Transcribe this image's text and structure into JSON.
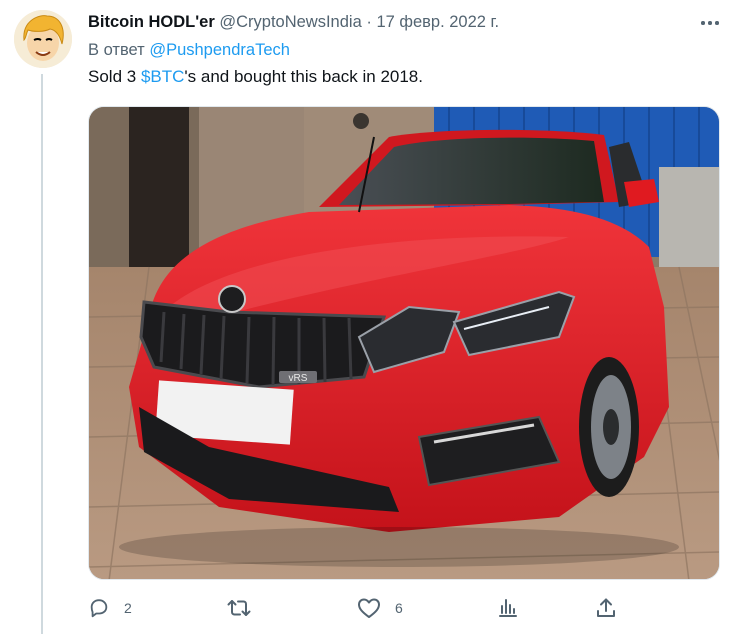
{
  "author": {
    "display_name": "Bitcoin HODL'er",
    "handle": "@CryptoNewsIndia",
    "separator": "·",
    "date": "17 февр. 2022 г."
  },
  "reply": {
    "prefix": "В ответ",
    "to_handle": "@PushpendraTech"
  },
  "text": {
    "before": "Sold 3 ",
    "cashtag": "$BTC",
    "after": "'s and bought this back in 2018."
  },
  "media": {
    "badge_text": "vRS"
  },
  "actions": {
    "reply_count": "2",
    "retweet_count": "",
    "like_count": "6"
  },
  "colors": {
    "link": "#1d9bf0",
    "muted": "#536471",
    "car_red": "#e0191f"
  },
  "icons": [
    "avatar",
    "more-icon",
    "reply-icon",
    "retweet-icon",
    "like-icon",
    "analytics-icon",
    "share-icon"
  ]
}
